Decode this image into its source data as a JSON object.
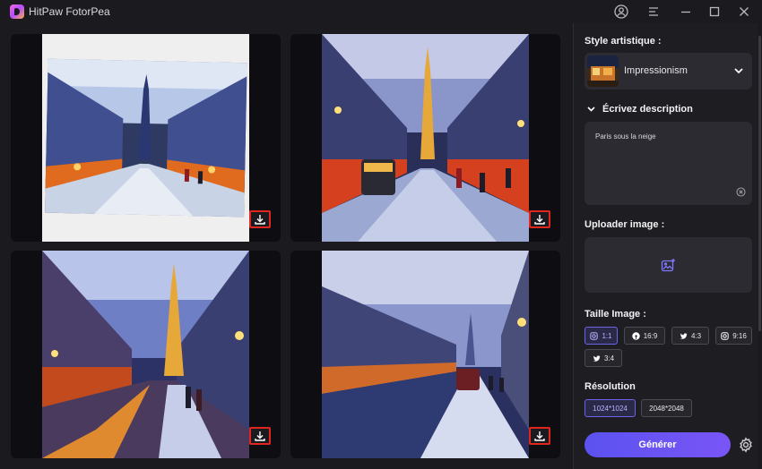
{
  "app": {
    "title": "HitPaw FotorPea"
  },
  "gallery": {
    "images": [
      {
        "id": 1
      },
      {
        "id": 2
      },
      {
        "id": 3
      },
      {
        "id": 4
      }
    ]
  },
  "panel": {
    "style_label": "Style artistique :",
    "style_value": "Impressionism",
    "desc_label": "Écrivez description",
    "desc_text": "Paris sous la neige",
    "upload_label": "Uploader image :",
    "size_label": "Taille Image :",
    "sizes": [
      "1:1",
      "16:9",
      "4:3",
      "9:16",
      "3:4"
    ],
    "size_selected": "1:1",
    "res_label": "Résolution",
    "resolutions": [
      "1024*1024",
      "2048*2048"
    ],
    "res_selected": "1024*1024",
    "generate_label": "Générer"
  },
  "colors": {
    "accent": "#6b63e8",
    "highlight": "#e0261e",
    "panel_bg": "#1e1e22"
  }
}
